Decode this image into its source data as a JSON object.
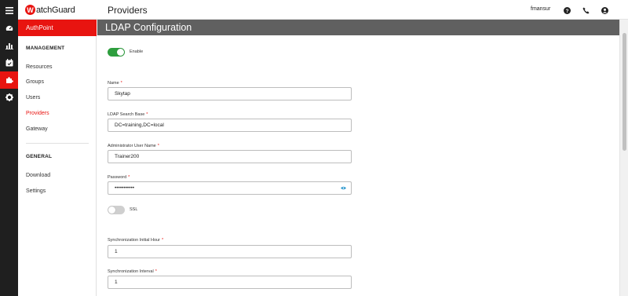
{
  "app": {
    "logo_letter": "W",
    "logo_text": "atchGuard",
    "header_title": "Providers",
    "username": "fmansur"
  },
  "rail": {
    "icons": [
      "menu-icon",
      "dashboard-icon",
      "reports-icon",
      "calendar-icon",
      "puzzle-icon",
      "gear-icon"
    ],
    "active": "puzzle-icon"
  },
  "header_icons": [
    "help-icon",
    "phone-icon",
    "user-account-icon"
  ],
  "sidebar": {
    "product": "AuthPoint",
    "management_heading": "MANAGEMENT",
    "items": [
      {
        "label": "Resources"
      },
      {
        "label": "Groups"
      },
      {
        "label": "Users"
      },
      {
        "label": "Providers"
      },
      {
        "label": "Gateway"
      }
    ],
    "general_heading": "GENERAL",
    "general_items": [
      {
        "label": "Download"
      },
      {
        "label": "Settings"
      }
    ],
    "active_item": "Providers"
  },
  "page": {
    "title": "LDAP Configuration",
    "enable_label": "Enable",
    "enable_on": true,
    "ssl_label": "SSL",
    "ssl_on": false,
    "fields": {
      "name": {
        "label": "Name",
        "value": "Skytap"
      },
      "search_base": {
        "label": "LDAP Search Base",
        "value": "DC=training,DC=local"
      },
      "admin_user": {
        "label": "Administrator User Name",
        "value": "Trainer200"
      },
      "password": {
        "label": "Password",
        "value": "•••••••••••"
      },
      "sync_hour": {
        "label": "Synchronization Initial Hour",
        "value": "1"
      },
      "sync_interval": {
        "label": "Synchronization Interval",
        "value": "1"
      }
    },
    "required_marker": "*"
  },
  "colors": {
    "brand_red": "#e81410",
    "toggle_on": "#2e9e3e",
    "header_gray": "#606060",
    "rail_dark": "#1f1f1f"
  }
}
